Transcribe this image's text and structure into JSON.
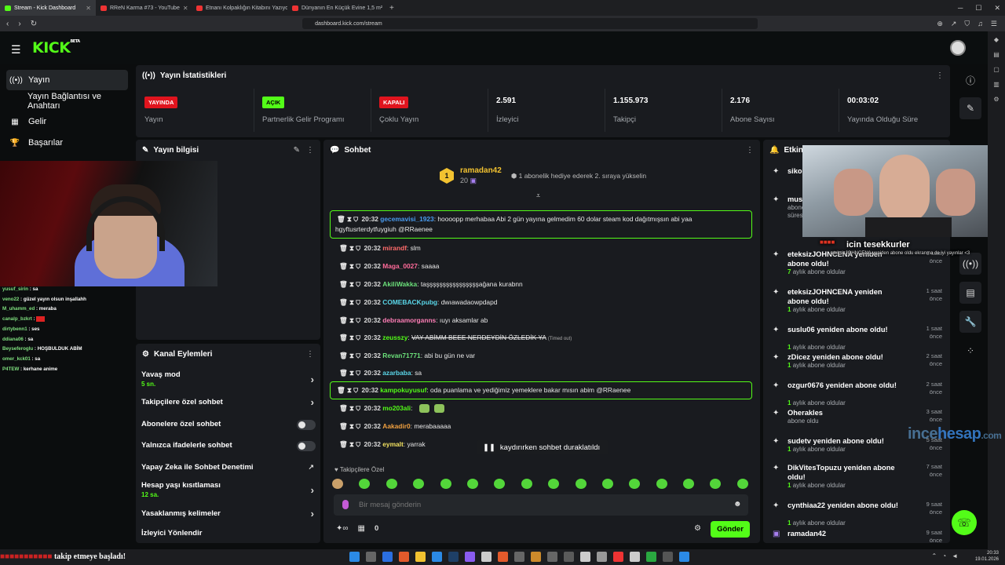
{
  "browser": {
    "tabs": [
      {
        "label": "Stream - Kick Dashboard",
        "color": "#53fc18",
        "active": true
      },
      {
        "label": "RReN Karma #73 - YouTube",
        "color": "#e33"
      },
      {
        "label": "Etnanı Kolpaklığın Kitabını Yazıyor | Se",
        "color": "#e33"
      },
      {
        "label": "Dünyanın En Küçük Evine 1,5 m² İzi",
        "color": "#e33"
      }
    ],
    "url": "dashboard.kick.com/stream"
  },
  "brand": {
    "logo": "KICK",
    "beta": "BETA",
    "accent": "#53fc18"
  },
  "nav": [
    {
      "label": "Yayın",
      "icon": "broadcast-icon",
      "selected": true
    },
    {
      "label": "Yayın Bağlantısı ve Anahtarı"
    },
    {
      "label": "Gelir",
      "icon": "revenue-icon"
    },
    {
      "label": "Başarılar",
      "icon": "trophy-icon"
    }
  ],
  "overlay_chat": [
    {
      "user": "yusuf_sirin",
      "text": "sa"
    },
    {
      "user": "veno22",
      "text": "güzel yayın olsun inşallahh"
    },
    {
      "user": "M_uhamm_ed",
      "text": "meraba"
    },
    {
      "user": "canalp_bzkrt",
      "text": "",
      "redacted": true
    },
    {
      "user": "dirtybenn1",
      "text": "ses"
    },
    {
      "user": "ddiana06",
      "text": "sa"
    },
    {
      "user": "Beyseferoglu",
      "text": "HOŞBULDUK ABİM"
    },
    {
      "user": "omer_kck01",
      "text": "sa"
    },
    {
      "user": "P4TEW",
      "text": "kerhane anime"
    }
  ],
  "stats": {
    "title": "Yayın İstatistikleri",
    "items": [
      {
        "badge": "YAYINDA",
        "badge_color": "#e0141e",
        "label": "Yayın"
      },
      {
        "badge": "AÇIK",
        "badge_color": "#53fc18",
        "label": "Partnerlik Gelir Programı"
      },
      {
        "badge": "KAPALI",
        "badge_color": "#e0141e",
        "label": "Çoklu Yayın"
      },
      {
        "value": "2.591",
        "label": "İzleyici"
      },
      {
        "value": "1.155.973",
        "label": "Takipçi"
      },
      {
        "value": "2.176",
        "label": "Abone Sayısı"
      },
      {
        "value": "00:03:02",
        "label": "Yayında Olduğu Süre"
      }
    ]
  },
  "stream_info": {
    "title": "Yayın bilgisi"
  },
  "channel_actions": {
    "title": "Kanal Eylemleri",
    "items": [
      {
        "label": "Yavaş mod",
        "sub": "5 sn.",
        "kind": "chevron"
      },
      {
        "label": "Takipçilere özel sohbet",
        "kind": "chevron"
      },
      {
        "label": "Abonelere özel sohbet",
        "kind": "toggle"
      },
      {
        "label": "Yalnızca ifadelerle sohbet",
        "kind": "toggle"
      },
      {
        "label": "Yapay Zeka ile Sohbet Denetimi",
        "kind": "external"
      },
      {
        "label": "Hesap yaşı kısıtlaması",
        "sub": "12 sa.",
        "kind": "chevron"
      },
      {
        "label": "Yasaklanmış kelimeler",
        "kind": "chevron"
      },
      {
        "label": "İzleyici Yönlendir",
        "kind": "none"
      }
    ]
  },
  "chat": {
    "title": "Sohbet",
    "pinned": {
      "user": "ramadan42",
      "count": "20",
      "rank": "1",
      "text": "1 abonelik hediye ederek 2. sıraya yükselin"
    },
    "messages": [
      {
        "time": "20:32",
        "user": "gecemavisi_1923",
        "color": "#4a9cf0",
        "text": "hoooopp merhabaa Abi 2 gün yayına gelmedim 60 dolar steam kod dağıtmışsın abi yaa hgyftusrterdytfuygiuh @RRaenee",
        "highlight": true
      },
      {
        "time": "20:32",
        "user": "mirandf",
        "color": "#ff6b6b",
        "text": "slm"
      },
      {
        "time": "20:32",
        "user": "Maga_0027",
        "color": "#ff6b9a",
        "text": "saaaa"
      },
      {
        "time": "20:32",
        "user": "AkiliWakka",
        "color": "#6be07a",
        "text": "taşşşşşşşşşşşşşşşşağana kurabnn"
      },
      {
        "time": "20:32",
        "user": "COMEBACKpubg",
        "color": "#5ad6e8",
        "text": "dwıawadaowpdapd"
      },
      {
        "time": "20:32",
        "user": "debraamorganns",
        "color": "#ff7eb6",
        "text": "ıuyı aksamlar ab"
      },
      {
        "time": "20:32",
        "user": "zeusszy",
        "color": "#53fc18",
        "text": "VAY ABİMM BEEE NERDEYDİN ÖZLEDİK YA",
        "note": "(Timed out)",
        "struck": true
      },
      {
        "time": "20:32",
        "user": "Revan71771",
        "color": "#6be07a",
        "text": "abi bu gün ne var"
      },
      {
        "time": "20:32",
        "user": "azarbaba",
        "color": "#5ad6e8",
        "text": "sa"
      },
      {
        "time": "20:32",
        "user": "kampokuyusuf",
        "color": "#53fc18",
        "text": "oda puanlama ve yediğimiz yemeklere bakar mısın abim @RRaenee",
        "highlight": true
      },
      {
        "time": "20:32",
        "user": "mo203ali",
        "color": "#53fc18",
        "text": "",
        "emotes": 2
      },
      {
        "time": "20:32",
        "user": "Aakadir0",
        "color": "#f0a040",
        "text": "merabaaaaa"
      },
      {
        "time": "20:32",
        "user": "eymalt",
        "color": "#f0e060",
        "text": "yarrak"
      }
    ],
    "paused": "kaydırırken sohbet duraklatıldı",
    "followers_label": "Takipçilere Özel",
    "input_placeholder": "Bir mesaj gönderin",
    "points": "0",
    "send": "Gönder"
  },
  "events": {
    "title": "Etkinlikler",
    "items": [
      {
        "title": "sikos",
        "sub": "",
        "time": ""
      },
      {
        "title": "musta",
        "sub": "abone",
        "sub2": "süresi",
        "time": ""
      },
      {
        "title": "eteksizJOHNCENA yeniden abone oldu!",
        "months": "7",
        "sub": "aylık abone oldular",
        "time": "1 saat önce"
      },
      {
        "title": "eteksizJOHNCENA yeniden abone oldu!",
        "months": "1",
        "sub": "aylık abone oldular",
        "time": "1 saat önce"
      },
      {
        "title": "suslu06 yeniden abone oldu!",
        "months": "1",
        "sub": "aylık abone oldular",
        "time": "1 saat önce"
      },
      {
        "title": "zDicez yeniden abone oldu!",
        "months": "1",
        "sub": "aylık abone oldular",
        "time": "2 saat önce"
      },
      {
        "title": "ozgur0676 yeniden abone oldu!",
        "months": "1",
        "sub": "aylık abone oldular",
        "time": "2 saat önce"
      },
      {
        "title": "Oherakles",
        "sub": "abone oldu",
        "time": "3 saat önce"
      },
      {
        "title": "sudetv yeniden abone oldu!",
        "months": "1",
        "sub": "aylık abone oldular",
        "time": "5 saat önce"
      },
      {
        "title": "DikVitesTopuzu yeniden abone oldu!",
        "months": "1",
        "sub": "aylık abone oldular",
        "time": "7 saat önce"
      },
      {
        "title": "cynthiaa22 yeniden abone oldu!",
        "months": "1",
        "sub": "aylık abone oldular",
        "time": "9 saat önce"
      },
      {
        "title": "ramadan42",
        "sub": "",
        "time": "9 saat önce"
      }
    ]
  },
  "overlays": {
    "thanks": "icin tesekkurler",
    "thanks_tiny": "eteksizJOHNCENA yeniden abone oldu ekranına de iyi yayınlar <3",
    "watermark_a": "ince",
    "watermark_b": "hesap",
    "watermark_c": ".com",
    "follow_text": "takip etmeye başladı!"
  },
  "taskbar": {
    "time": "20:33",
    "date": "19.01.2026"
  }
}
